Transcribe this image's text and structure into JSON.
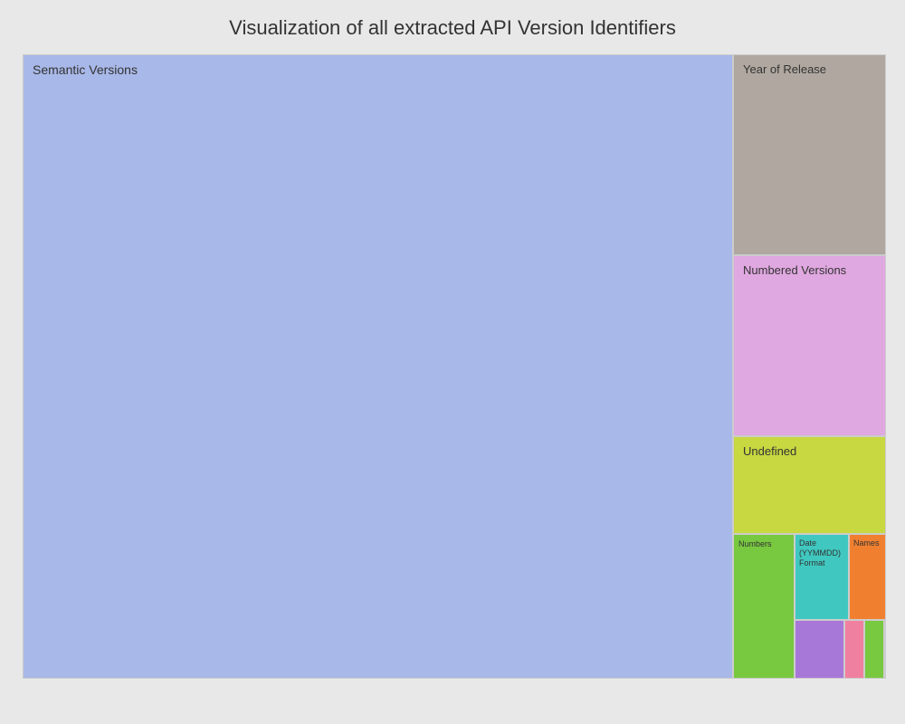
{
  "page": {
    "title": "Visualization of all extracted API Version Identifiers"
  },
  "treemap": {
    "blocks": {
      "semantic_versions": {
        "label": "Semantic Versions",
        "color": "#a8b8e8"
      },
      "year_of_release": {
        "label": "Year of Release",
        "color": "#b0a8a0"
      },
      "numbered_versions": {
        "label": "Numbered Versions",
        "color": "#e0a8e0"
      },
      "undefined": {
        "label": "Undefined",
        "color": "#c8d840"
      },
      "numbers": {
        "label": "Numbers",
        "color": "#78c840"
      },
      "date_format": {
        "label": "Date (YYMMDD) Format",
        "color": "#40c8c0"
      },
      "names": {
        "label": "Names",
        "color": "#f08030"
      }
    }
  }
}
